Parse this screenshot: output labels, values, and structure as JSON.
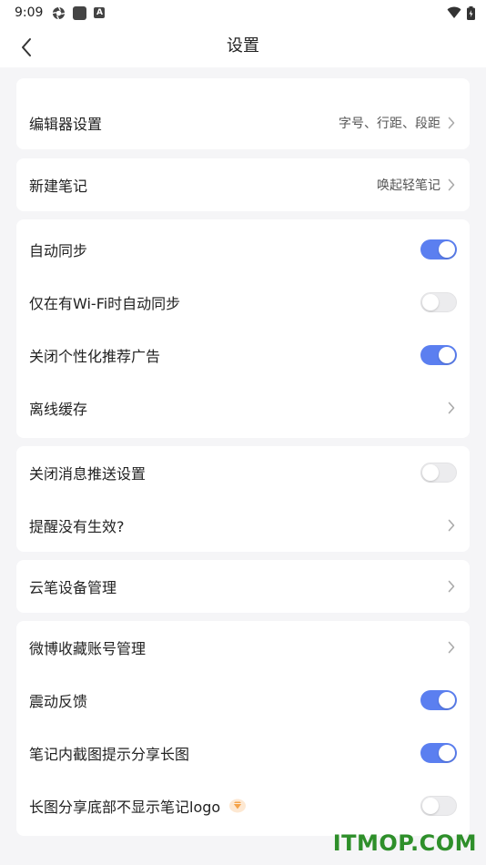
{
  "status_bar": {
    "time": "9:09"
  },
  "header": {
    "title": "设置"
  },
  "cards": {
    "editor": {
      "label": "编辑器设置",
      "value": "字号、行距、段距"
    },
    "new_note": {
      "label": "新建笔记",
      "value": "唤起轻笔记"
    },
    "sync": {
      "auto_sync": "自动同步",
      "wifi_only": "仅在有Wi-Fi时自动同步",
      "close_ads": "关闭个性化推荐广告",
      "offline_cache": "离线缓存"
    },
    "notify": {
      "close_push": "关闭消息推送设置",
      "reminder": "提醒没有生效?"
    },
    "pen": {
      "device_manage": "云笔设备管理"
    },
    "misc": {
      "weibo": "微博收藏账号管理",
      "vibration": "震动反馈",
      "screenshot_share": "笔记内截图提示分享长图",
      "hide_logo": "长图分享底部不显示笔记logo"
    }
  },
  "toggles": {
    "auto_sync": true,
    "wifi_only": false,
    "close_ads": true,
    "close_push": false,
    "vibration": true,
    "screenshot_share": true,
    "hide_logo": false
  },
  "colors": {
    "accent": "#5b7ff0",
    "vip": "#f5a34a",
    "watermark": "#2e8f2a"
  },
  "icons": {
    "back": "chevron-left-icon",
    "row_arrow": "chevron-right-icon",
    "vip": "diamond-icon"
  },
  "watermark": {
    "text": "ITMOP.COM"
  }
}
